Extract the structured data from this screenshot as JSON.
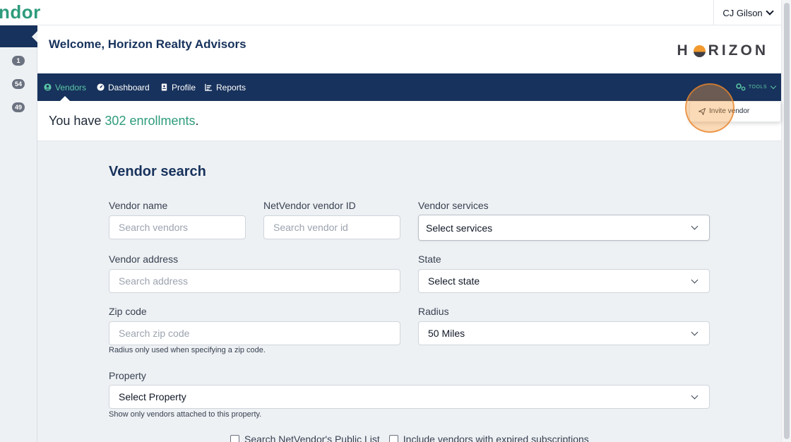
{
  "topbar": {
    "brand_fragment": "ndor",
    "user_name": "CJ Gilson"
  },
  "siderail": {
    "badges": [
      "1",
      "54",
      "49"
    ]
  },
  "header": {
    "welcome": "Welcome, Horizon Realty Advisors",
    "logo_left": "H",
    "logo_right": "RIZON"
  },
  "nav": {
    "items": [
      {
        "label": "Vendors",
        "icon": "user-circle-icon",
        "active": true
      },
      {
        "label": "Dashboard",
        "icon": "gauge-icon",
        "active": false
      },
      {
        "label": "Profile",
        "icon": "id-card-icon",
        "active": false
      },
      {
        "label": "Reports",
        "icon": "bar-chart-icon",
        "active": false
      }
    ],
    "tools_label": "TOOLS"
  },
  "tools_menu": {
    "items": [
      {
        "label": "Invite vendor",
        "icon": "paper-plane-icon"
      }
    ]
  },
  "enrollment": {
    "prefix": "You have ",
    "count": "302 enrollments",
    "suffix": "."
  },
  "vendor_search": {
    "title": "Vendor search",
    "vendor_name": {
      "label": "Vendor name",
      "placeholder": "Search vendors"
    },
    "vendor_id": {
      "label": "NetVendor vendor ID",
      "placeholder": "Search vendor id"
    },
    "services": {
      "label": "Vendor services",
      "value": "Select services"
    },
    "address": {
      "label": "Vendor address",
      "placeholder": "Search address"
    },
    "state": {
      "label": "State",
      "value": "Select state"
    },
    "zip": {
      "label": "Zip code",
      "placeholder": "Search zip code",
      "help": "Radius only used when specifying a zip code."
    },
    "radius": {
      "label": "Radius",
      "value": "50 Miles"
    },
    "property": {
      "label": "Property",
      "value": "Select Property",
      "help": "Show only vendors attached to this property."
    },
    "checkboxes": [
      {
        "label": "Search NetVendor's Public List",
        "checked": false
      },
      {
        "label": "Include vendors with expired subscriptions",
        "checked": false
      }
    ]
  },
  "colors": {
    "navy": "#17325c",
    "accent_green": "#2e9b7c",
    "nav_active": "#5cc6a6",
    "highlight": "#f29a2e"
  }
}
